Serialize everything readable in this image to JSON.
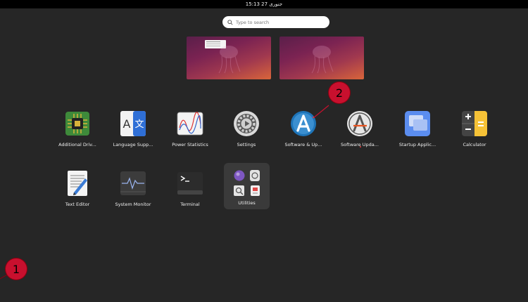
{
  "topbar": {
    "clock": "15:13  27 جنوری"
  },
  "search": {
    "placeholder": "Type to search"
  },
  "workspaces": [
    {
      "label": ""
    },
    {
      "label": ""
    }
  ],
  "apps_row1": [
    {
      "label": "Additional Driv...",
      "icon": "chip-icon"
    },
    {
      "label": "Language Supp...",
      "icon": "language-icon"
    },
    {
      "label": "Power Statistics",
      "icon": "power-stats-icon"
    },
    {
      "label": "Settings",
      "icon": "gear-icon"
    },
    {
      "label": "Software & Up...",
      "icon": "software-updates-icon"
    },
    {
      "label": "Software Upda...",
      "icon": "software-updater-icon"
    },
    {
      "label": "Startup Applic...",
      "icon": "startup-apps-icon"
    },
    {
      "label": "Calculator",
      "icon": "calculator-icon"
    }
  ],
  "apps_row2": [
    {
      "label": "Text Editor",
      "icon": "text-editor-icon"
    },
    {
      "label": "System Monitor",
      "icon": "system-monitor-icon"
    },
    {
      "label": "Terminal",
      "icon": "terminal-icon"
    }
  ],
  "folder": {
    "label": "Utilities"
  },
  "markers": [
    {
      "text": "1"
    },
    {
      "text": "2"
    }
  ],
  "colors": {
    "background": "#262626",
    "marker": "#c8102e",
    "accent": "#e95420"
  }
}
